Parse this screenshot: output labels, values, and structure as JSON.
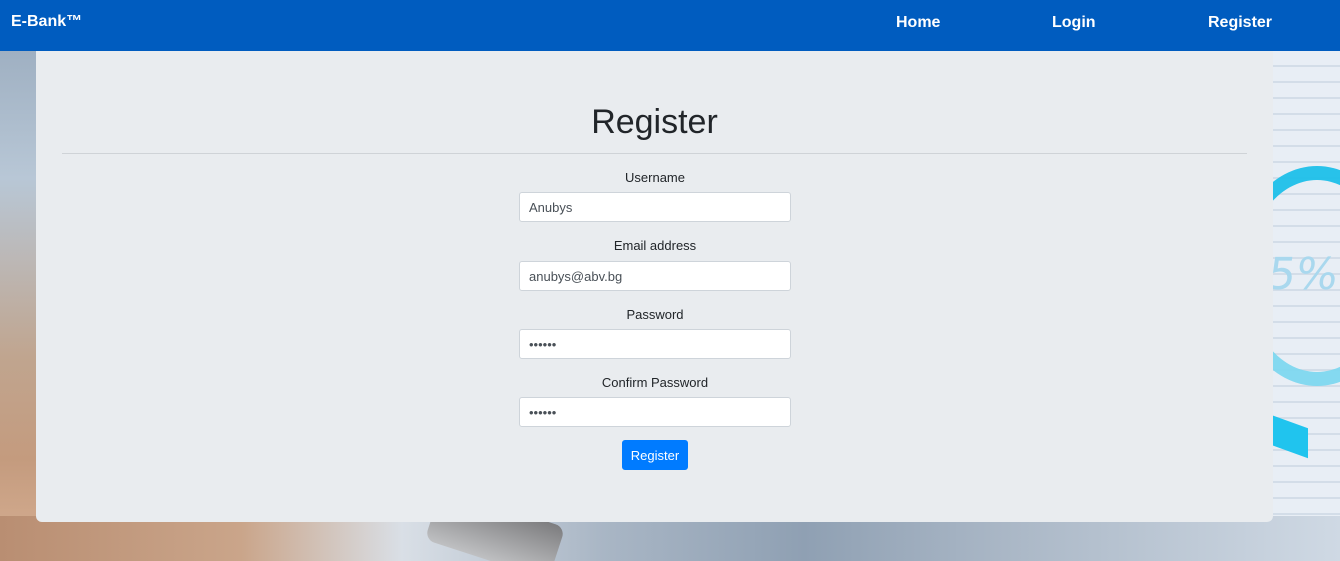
{
  "navbar": {
    "brand": "E-Bank™",
    "links": {
      "home": "Home",
      "login": "Login",
      "register": "Register"
    },
    "bg_color": "#005cbf"
  },
  "background": {
    "gauge_text": "5%"
  },
  "form": {
    "title": "Register",
    "fields": {
      "username": {
        "label": "Username",
        "value": "Anubys"
      },
      "email": {
        "label": "Email address",
        "value": "anubys@abv.bg"
      },
      "password": {
        "label": "Password",
        "value": "••••••"
      },
      "confirm_password": {
        "label": "Confirm Password",
        "value": "••••••"
      }
    },
    "submit_label": "Register",
    "accent_color": "#007bff"
  }
}
